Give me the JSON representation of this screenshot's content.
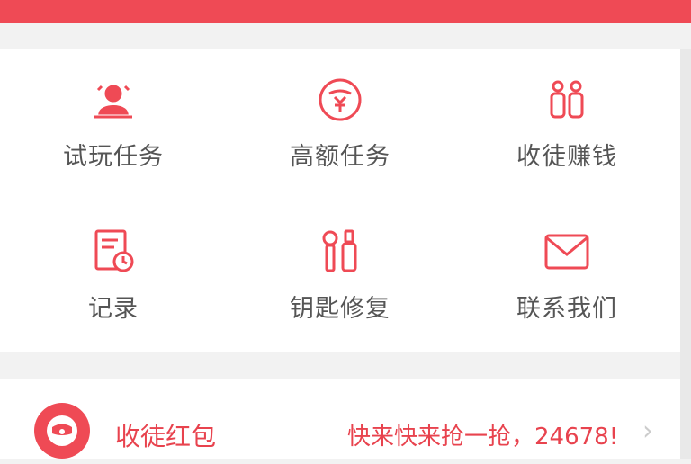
{
  "colors": {
    "accent": "#ef4a55",
    "label": "#555555",
    "chevron": "#cccccc"
  },
  "grid": {
    "items": [
      {
        "label": "试玩任务",
        "icon": "trial-player-icon"
      },
      {
        "label": "高额任务",
        "icon": "money-coin-icon"
      },
      {
        "label": "收徒赚钱",
        "icon": "people-icon"
      },
      {
        "label": "记录",
        "icon": "record-document-icon"
      },
      {
        "label": "钥匙修复",
        "icon": "key-tools-icon"
      },
      {
        "label": "联系我们",
        "icon": "mail-icon"
      }
    ]
  },
  "redpacket": {
    "title": "收徒红包",
    "promo": "快来快来抢一抢，24678!",
    "icon": "red-packet-icon",
    "chevron": "›"
  }
}
